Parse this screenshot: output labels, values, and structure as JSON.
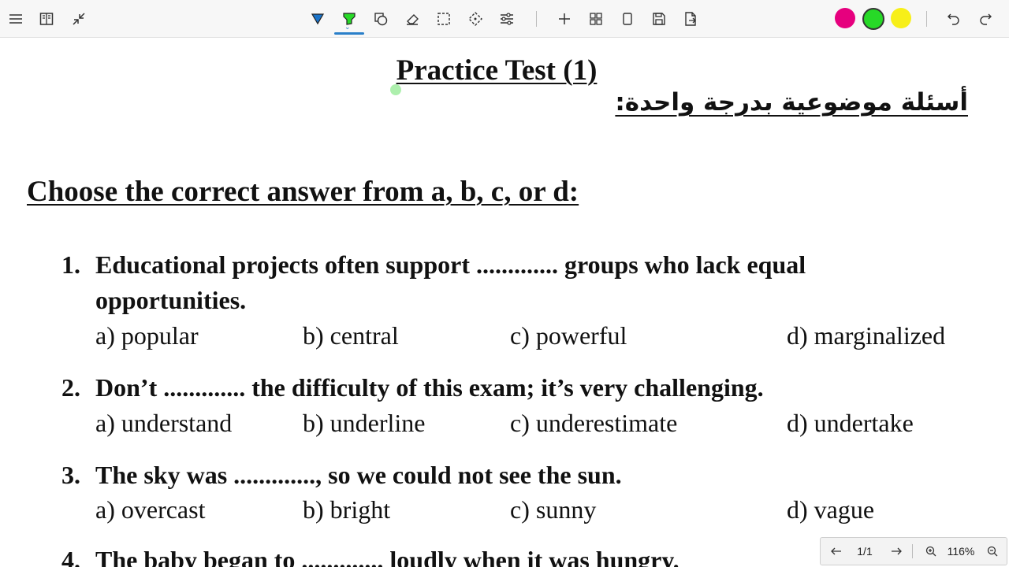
{
  "toolbar": {
    "icons": [
      "menu-icon",
      "book-icon",
      "collapse-icon",
      "pen-icon",
      "highlighter-icon",
      "shapes-icon",
      "eraser-icon",
      "lasso-icon",
      "move-icon",
      "adjust-icon",
      "add-icon",
      "thumbnails-icon",
      "page-icon",
      "save-icon",
      "export-icon",
      "undo-icon",
      "redo-icon"
    ],
    "colors": [
      "#e6007e",
      "#27d927",
      "#f7ef18"
    ]
  },
  "document": {
    "title": "Practice Test (1)",
    "arabic_heading": "أسئلة موضوعية بدرجة واحدة:",
    "instruction": "Choose the correct answer from a, b, c, or d:",
    "questions": [
      {
        "number": "1.",
        "text": "Educational projects often support ............. groups who lack equal opportunities.",
        "options": [
          "a) popular",
          "b) central",
          "c) powerful",
          "d) marginalized"
        ]
      },
      {
        "number": "2.",
        "text": "Don’t ............. the difficulty of this exam; it’s very challenging.",
        "options": [
          "a) understand",
          "b) underline",
          "c) underestimate",
          "d) undertake"
        ]
      },
      {
        "number": "3.",
        "text": "The sky was ............., so we could not see the sun.",
        "options": [
          "a) overcast",
          "b) bright",
          "c) sunny",
          "d) vague"
        ]
      },
      {
        "number": "4.",
        "text": "The baby began to ............. loudly when it was hungry."
      }
    ]
  },
  "pagenav": {
    "page": "1/1",
    "zoom": "116%"
  }
}
